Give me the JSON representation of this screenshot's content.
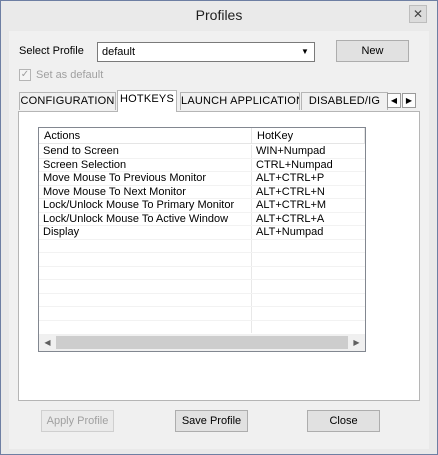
{
  "window": {
    "title": "Profiles",
    "close_glyph": "✕"
  },
  "profile": {
    "label": "Select Profile",
    "selected": "default",
    "new_button": "New",
    "set_default_label": "Set as default"
  },
  "tabs": [
    {
      "label": "CONFIGURATION"
    },
    {
      "label": "HOTKEYS"
    },
    {
      "label": "LAUNCH APPLICATION"
    },
    {
      "label": "DISABLED/IG"
    }
  ],
  "hotkeys_table": {
    "headers": [
      "Actions",
      "HotKey"
    ],
    "rows": [
      [
        "Send to Screen",
        "WIN+Numpad"
      ],
      [
        "Screen Selection",
        "CTRL+Numpad"
      ],
      [
        "Move Mouse To Previous Monitor",
        "ALT+CTRL+P"
      ],
      [
        "Move Mouse To Next Monitor",
        "ALT+CTRL+N"
      ],
      [
        "Lock/Unlock Mouse To Primary Monitor",
        "ALT+CTRL+M"
      ],
      [
        "Lock/Unlock Mouse To Active Window",
        "ALT+CTRL+A"
      ],
      [
        "Display",
        "ALT+Numpad"
      ]
    ]
  },
  "footer": {
    "apply_button": "Apply Profile",
    "save_button": "Save Profile",
    "close_button": "Close"
  }
}
